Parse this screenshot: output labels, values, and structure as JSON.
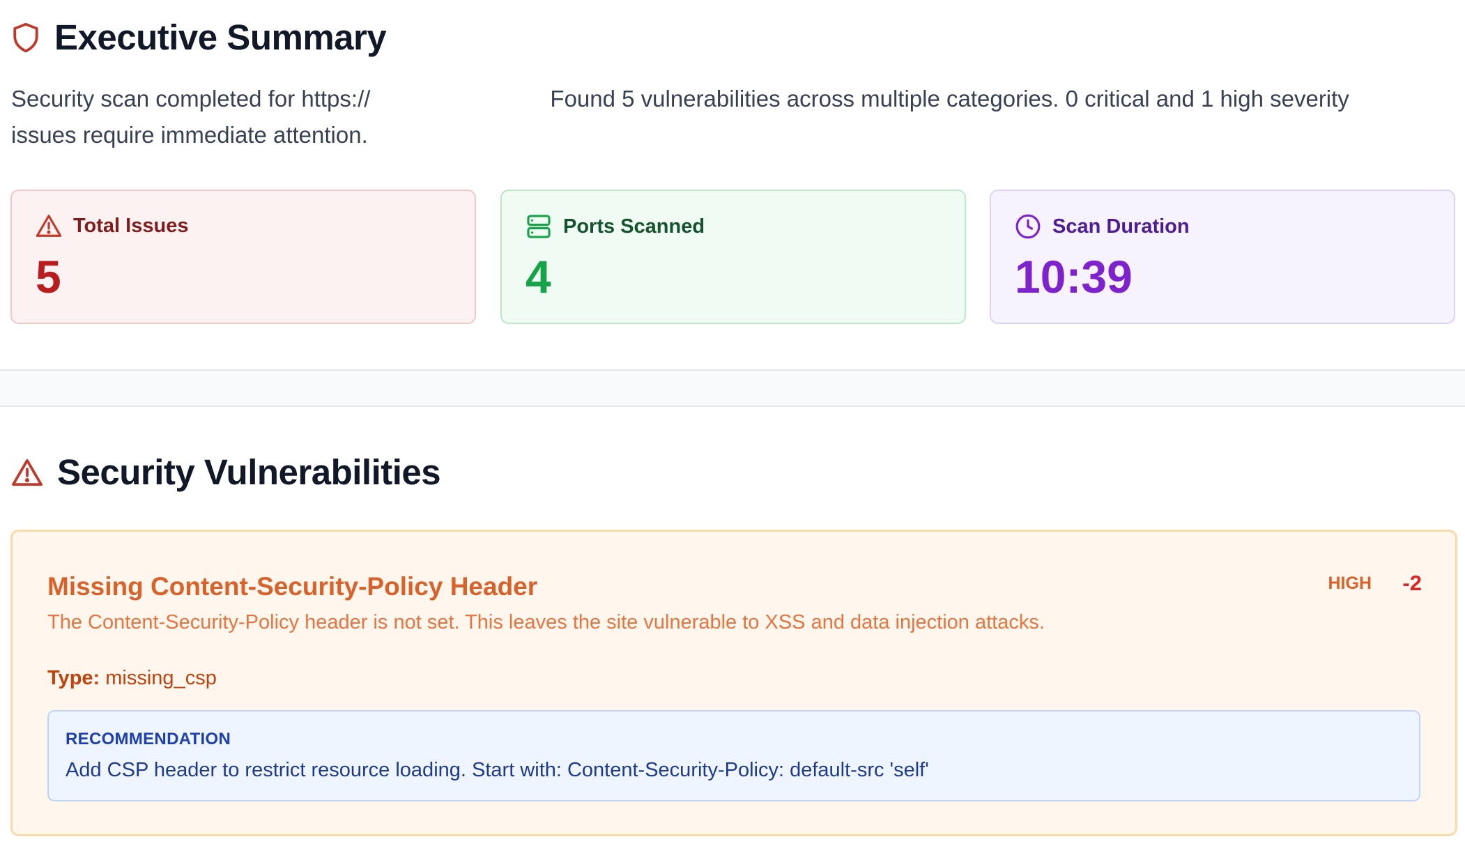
{
  "executive_summary": {
    "title": "Executive Summary",
    "summary_part1": "Security scan completed for https://",
    "summary_part2": "Found 5 vulnerabilities across multiple categories. 0 critical and 1 high severity",
    "summary_line2": "issues require immediate attention."
  },
  "stats": [
    {
      "label": "Total Issues",
      "value": "5",
      "icon": "alert-triangle-icon"
    },
    {
      "label": "Ports Scanned",
      "value": "4",
      "icon": "server-icon"
    },
    {
      "label": "Scan Duration",
      "value": "10:39",
      "icon": "clock-icon"
    }
  ],
  "vulnerabilities_section": {
    "title": "Security Vulnerabilities"
  },
  "vulnerabilities": [
    {
      "title": "Missing Content-Security-Policy Header",
      "severity": "HIGH",
      "score": "-2",
      "description": "The Content-Security-Policy header is not set. This leaves the site vulnerable to XSS and data injection attacks.",
      "type_label": "Type:",
      "type_value": "missing_csp",
      "recommendation_label": "RECOMMENDATION",
      "recommendation": "Add CSP header to restrict resource loading. Start with: Content-Security-Policy: default-src 'self'"
    }
  ],
  "colors": {
    "red": "#b91c1c",
    "green": "#16a34a",
    "purple": "#7e22ce",
    "orange": "#d9622b",
    "blue": "#1e40af"
  }
}
